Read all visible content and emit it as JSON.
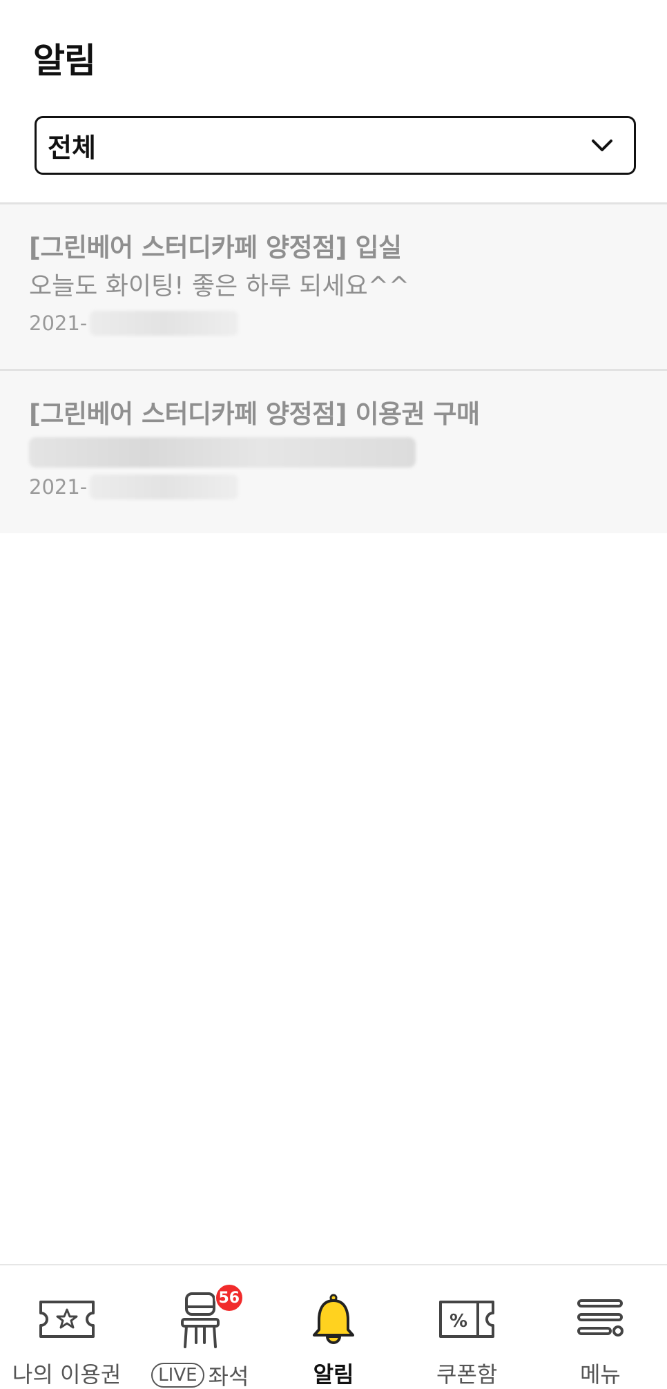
{
  "header": {
    "title": "알림"
  },
  "filter": {
    "selected": "전체"
  },
  "notifications": [
    {
      "title": "[그린베어 스터디카페 양정점] 입실",
      "message": "오늘도 화이팅! 좋은 하루 되세요^^",
      "date_prefix": "2021-"
    },
    {
      "title": "[그린베어 스터디카페 양정점] 이용권 구매",
      "message": "",
      "date_prefix": "2021-"
    }
  ],
  "tabbar": {
    "items": [
      {
        "label": "나의 이용권",
        "icon": "ticket-star-icon"
      },
      {
        "pill": "LIVE",
        "label": "좌석",
        "icon": "chair-icon",
        "badge": "56"
      },
      {
        "label": "알림",
        "icon": "bell-icon"
      },
      {
        "label": "쿠폰함",
        "icon": "coupon-percent-icon"
      },
      {
        "label": "메뉴",
        "icon": "menu-icon"
      }
    ],
    "active_index": 2
  },
  "colors": {
    "accent": "#FFD21F",
    "badge": "#F12B2B"
  }
}
